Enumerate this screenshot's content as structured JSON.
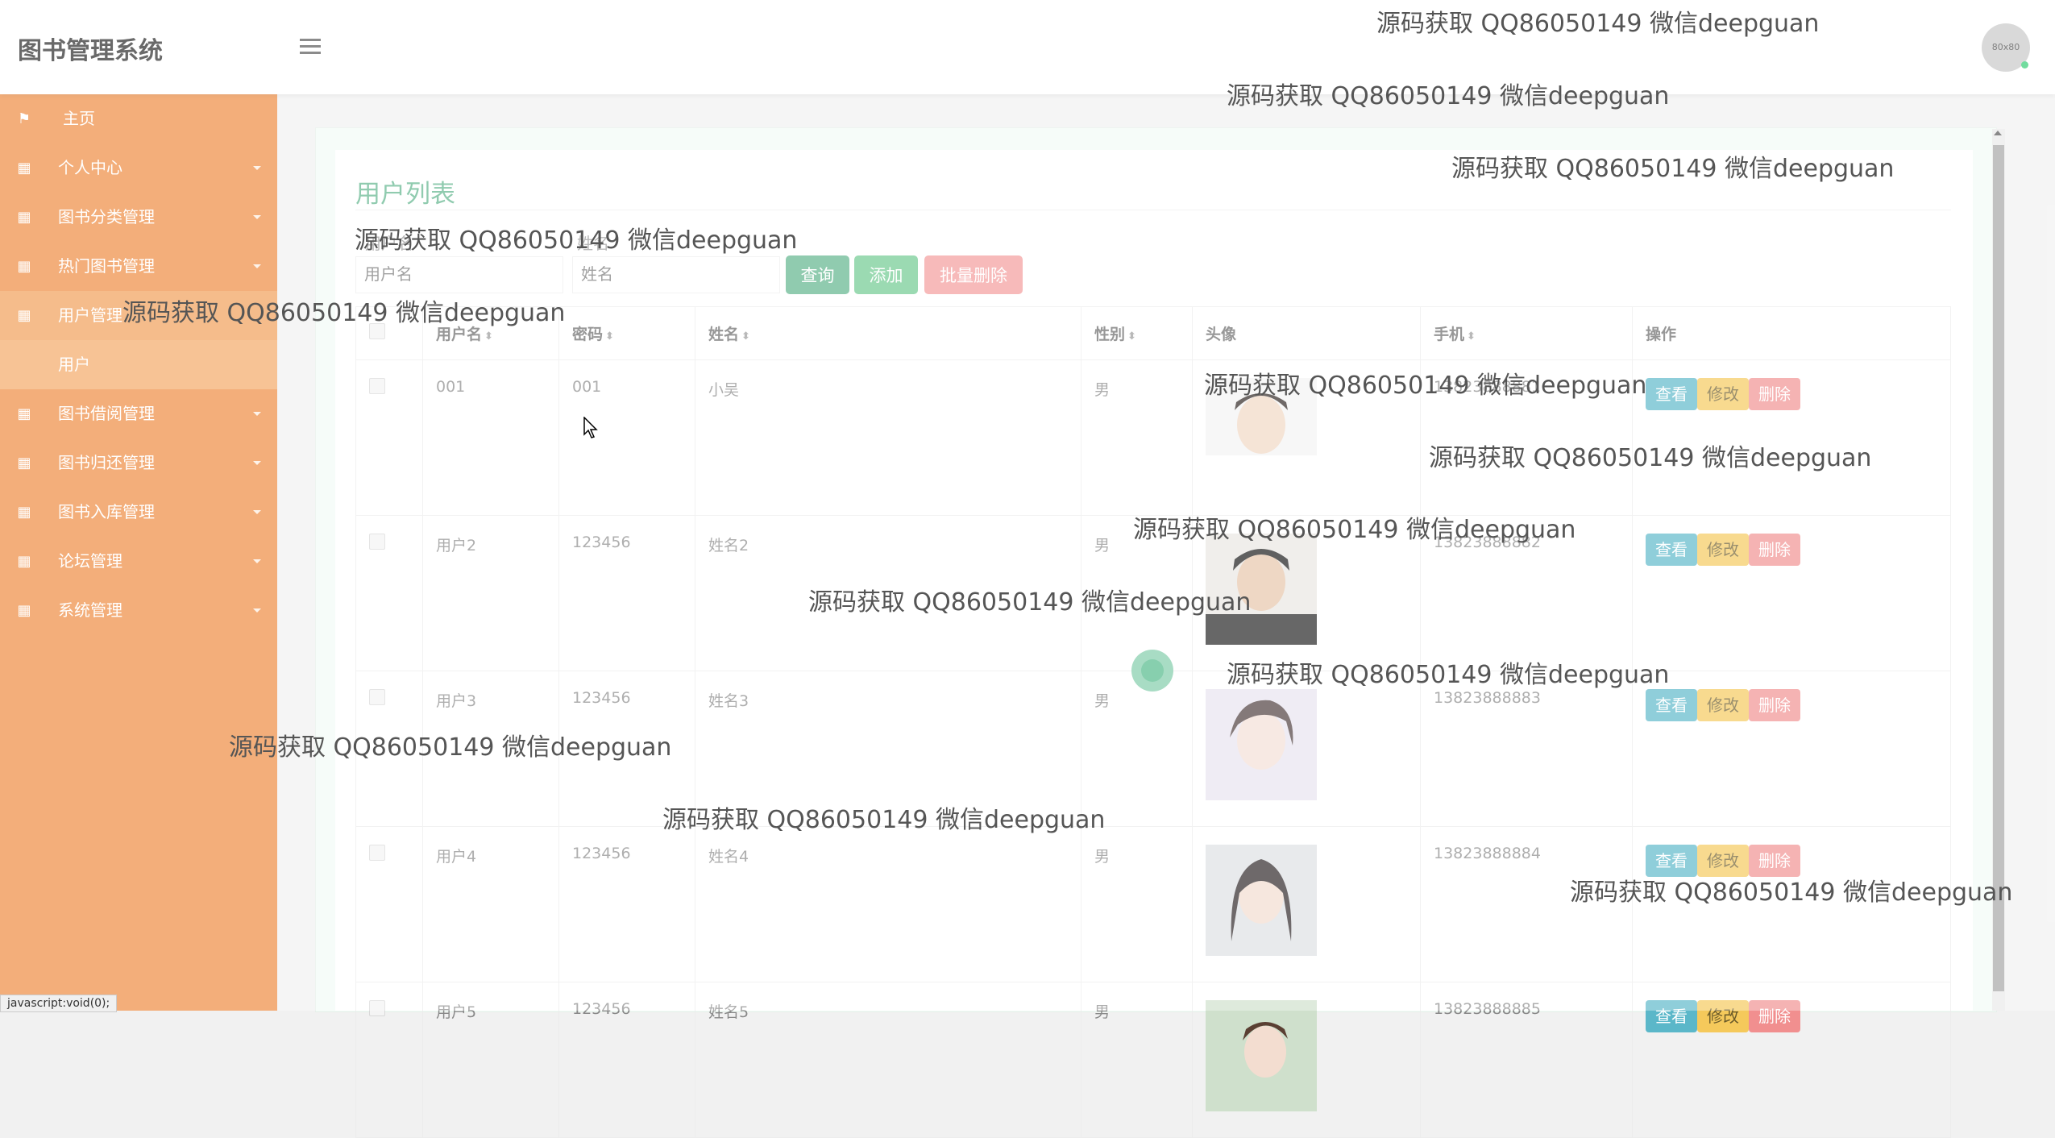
{
  "header": {
    "brand": "图书管理系统",
    "avatar_text": "80x80"
  },
  "sidebar": {
    "items": [
      {
        "label": "主页",
        "icon": "flag-icon"
      },
      {
        "label": "个人中心",
        "icon": "grid-icon"
      },
      {
        "label": "图书分类管理",
        "icon": "grid-icon"
      },
      {
        "label": "热门图书管理",
        "icon": "grid-icon"
      },
      {
        "label": "用户管理",
        "icon": "grid-icon"
      },
      {
        "label": "用户",
        "icon": ""
      },
      {
        "label": "图书借阅管理",
        "icon": "grid-icon"
      },
      {
        "label": "图书归还管理",
        "icon": "grid-icon"
      },
      {
        "label": "图书入库管理",
        "icon": "grid-icon"
      },
      {
        "label": "论坛管理",
        "icon": "grid-icon"
      },
      {
        "label": "系统管理",
        "icon": "grid-icon"
      }
    ]
  },
  "main": {
    "title": "用户列表",
    "search": {
      "username_label": "用户名",
      "name_label": "姓名",
      "username_placeholder": "用户名",
      "name_placeholder": "姓名"
    },
    "buttons": {
      "query": "查询",
      "add": "添加",
      "batch_delete": "批量删除"
    },
    "table": {
      "headers": [
        "用户名",
        "密码",
        "姓名",
        "性别",
        "头像",
        "手机",
        "操作"
      ],
      "rows": [
        {
          "username": "001",
          "password": "001",
          "name": "小吴",
          "gender": "男",
          "phone": "13823888881"
        },
        {
          "username": "用户2",
          "password": "123456",
          "name": "姓名2",
          "gender": "男",
          "phone": "13823888882"
        },
        {
          "username": "用户3",
          "password": "123456",
          "name": "姓名3",
          "gender": "男",
          "phone": "13823888883"
        },
        {
          "username": "用户4",
          "password": "123456",
          "name": "姓名4",
          "gender": "男",
          "phone": "13823888884"
        },
        {
          "username": "用户5",
          "password": "123456",
          "name": "姓名5",
          "gender": "男",
          "phone": "13823888885"
        }
      ],
      "actions": {
        "view": "查看",
        "edit": "修改",
        "delete": "删除"
      }
    }
  },
  "watermark": "源码获取 QQ86050149 微信deepguan",
  "statusbar": "javascript:void(0);",
  "colors": {
    "sidebar": "#ee883b",
    "accent_green": "#5cb38a",
    "view": "#5bb7c9",
    "edit": "#f5c95b",
    "delete": "#f18f8f"
  }
}
